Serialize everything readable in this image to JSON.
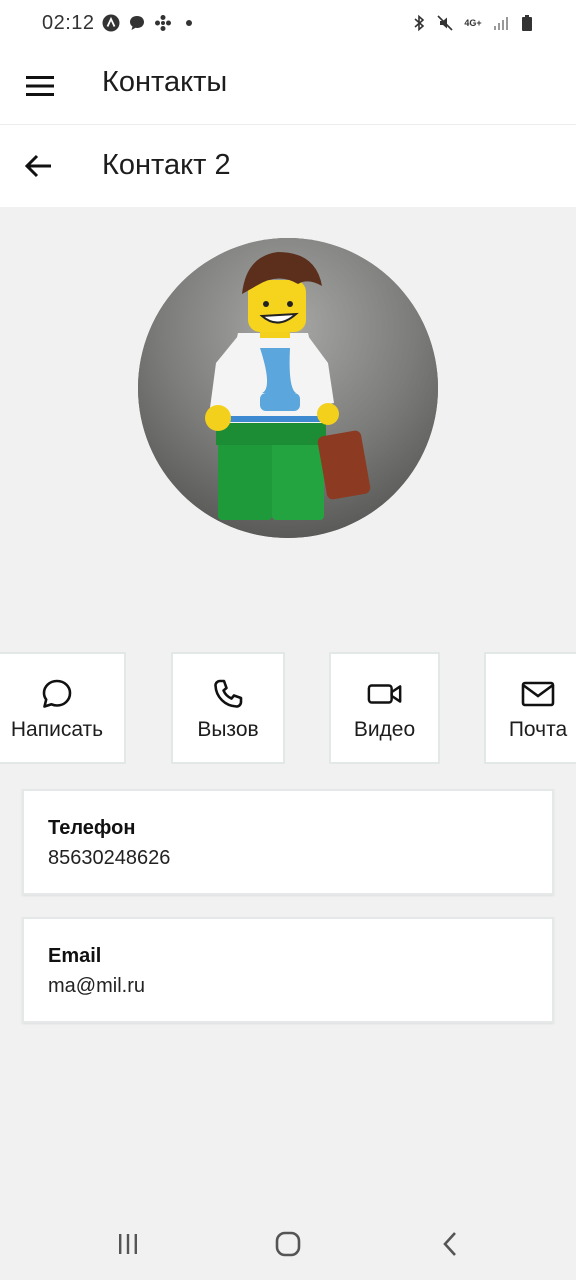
{
  "status_bar": {
    "time": "02:12",
    "left_icons": [
      "app-a-icon",
      "chat-bubble-icon",
      "fan-icon",
      "dot-icon"
    ],
    "right_icons": [
      "bluetooth-icon",
      "mute-icon",
      "network-4g-icon",
      "signal-icon",
      "battery-icon"
    ],
    "network_label": "4G+"
  },
  "app_bar": {
    "menu_icon": "hamburger-menu-icon",
    "title": "Контакты"
  },
  "sub_bar": {
    "back_icon": "arrow-left-icon",
    "title": "Контакт 2"
  },
  "avatar": {
    "description_icon": "lego-figure-photo"
  },
  "actions": [
    {
      "label": "Написать",
      "icon": "message-circle-icon"
    },
    {
      "label": "Вызов",
      "icon": "phone-icon"
    },
    {
      "label": "Видео",
      "icon": "video-camera-icon"
    },
    {
      "label": "Почта",
      "icon": "mail-icon"
    }
  ],
  "details": {
    "phone": {
      "title": "Телефон",
      "value": "85630248626"
    },
    "email": {
      "title": "Email",
      "value": "ma@mil.ru"
    }
  },
  "nav_bar": {
    "items": [
      "recent-apps-icon",
      "home-icon",
      "back-chevron-icon"
    ]
  },
  "colors": {
    "background": "#f1f1f1",
    "surface": "#ffffff",
    "card_border": "#e2e7e7",
    "text_primary": "#1d1d1d"
  }
}
